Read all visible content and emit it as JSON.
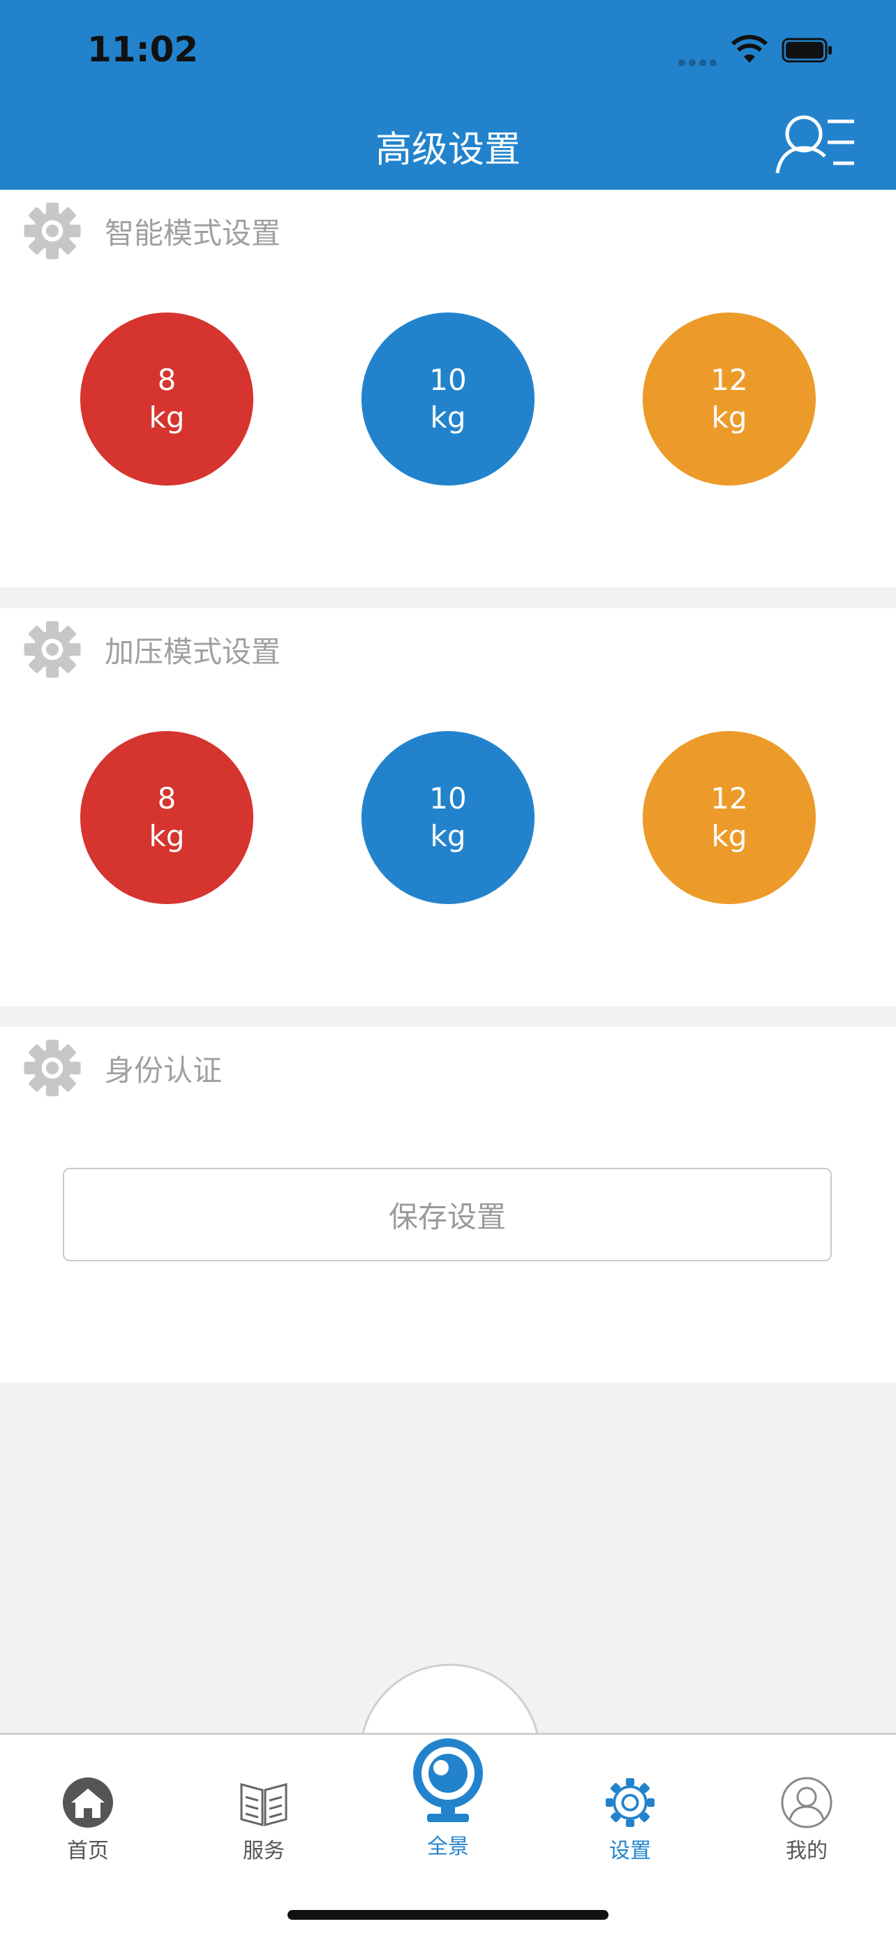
{
  "status": {
    "time": "11:02"
  },
  "nav": {
    "title": "高级设置",
    "menu_icon": "user-list-icon"
  },
  "sections": [
    {
      "title": "智能模式设置",
      "icon": "gear-icon",
      "options": [
        {
          "value": "8",
          "unit": "kg",
          "color": "#d5342f"
        },
        {
          "value": "10",
          "unit": "kg",
          "color": "#2283cc"
        },
        {
          "value": "12",
          "unit": "kg",
          "color": "#ec9b2a"
        }
      ]
    },
    {
      "title": "加压模式设置",
      "icon": "gear-icon",
      "options": [
        {
          "value": "8",
          "unit": "kg",
          "color": "#d5342f"
        },
        {
          "value": "10",
          "unit": "kg",
          "color": "#2283cc"
        },
        {
          "value": "12",
          "unit": "kg",
          "color": "#ec9b2a"
        }
      ]
    },
    {
      "title": "身份认证",
      "icon": "gear-icon"
    }
  ],
  "save_button": {
    "label": "保存设置"
  },
  "tabs": [
    {
      "label": "首页",
      "icon": "home-icon"
    },
    {
      "label": "服务",
      "icon": "book-icon"
    },
    {
      "label": "全景",
      "icon": "camera-icon"
    },
    {
      "label": "设置",
      "icon": "gear-icon",
      "active": true
    },
    {
      "label": "我的",
      "icon": "user-icon"
    }
  ],
  "colors": {
    "accent": "#2283cc",
    "red": "#d5342f",
    "orange": "#ec9b2a"
  }
}
